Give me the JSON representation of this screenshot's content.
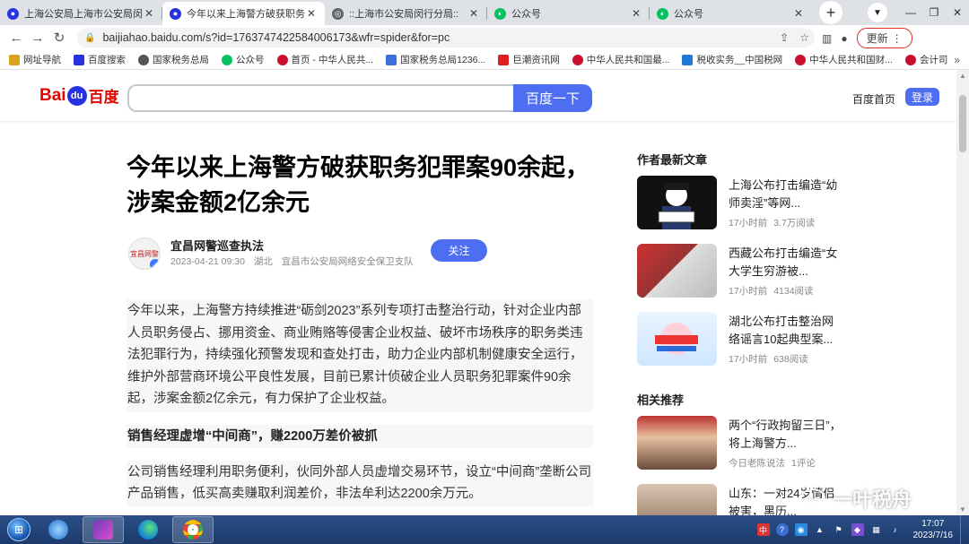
{
  "tabs": [
    {
      "label": "上海公安局上海市公安局闵行分局",
      "icon": "paw-icon",
      "color": "#2932e1",
      "active": false
    },
    {
      "label": "今年以来上海警方破获职务犯罪",
      "icon": "paw-icon",
      "color": "#2932e1",
      "active": true
    },
    {
      "label": "::上海市公安局闵行分局::",
      "icon": "globe-icon",
      "color": "#5f6368",
      "active": false
    },
    {
      "label": "公众号",
      "icon": "wechat-icon",
      "color": "#07c160",
      "active": false
    },
    {
      "label": "公众号",
      "icon": "wechat-icon",
      "color": "#07c160",
      "active": false
    }
  ],
  "address": {
    "url": "baijiahao.baidu.com/s?id=1763747422584006173&wfr=spider&for=pc",
    "update_label": "更新"
  },
  "bookmarks": [
    {
      "label": "网址导航",
      "color": "#d9a21b"
    },
    {
      "label": "百度搜索",
      "color": "#2932e1"
    },
    {
      "label": "国家税务总局",
      "color": "#555555"
    },
    {
      "label": "公众号",
      "color": "#07c160"
    },
    {
      "label": "首页 - 中华人民共...",
      "color": "#c8102e"
    },
    {
      "label": "国家税务总局1236...",
      "color": "#3b6fd9"
    },
    {
      "label": "巨潮资讯网",
      "color": "#e02020"
    },
    {
      "label": "中华人民共和国最...",
      "color": "#c8102e"
    },
    {
      "label": "税收实务__中国税网",
      "color": "#1b7bd6"
    },
    {
      "label": "中华人民共和国财...",
      "color": "#c8102e"
    },
    {
      "label": "会计司",
      "color": "#c8102e"
    }
  ],
  "header": {
    "logo_left": "Bai",
    "logo_du": "du",
    "logo_right": "百度",
    "search_button": "百度一下",
    "home_link": "百度首页",
    "login": "登录"
  },
  "article": {
    "title": "今年以来上海警方破获职务犯罪案90余起，涉案金额2亿余元",
    "author": "宜昌网警巡查执法",
    "avatar_text": "宜昌网警",
    "date": "2023-04-21 09:30",
    "location": "湖北",
    "org": "宜昌市公安局网络安全保卫支队",
    "follow": "关注",
    "p1": "今年以来，上海警方持续推进“砺剑2023”系列专项打击整治行动，针对企业内部人员职务侵占、挪用资金、商业贿赂等侵害企业权益、破坏市场秩序的职务类违法犯罪行为，持续强化预警发现和查处打击，助力企业内部机制健康安全运行，维护外部营商环境公平良性发展，目前已累计侦破企业人员职务犯罪案件90余起，涉案金额2亿余元，有力保护了企业权益。",
    "h1": "销售经理虚增“中间商”，赚2200万差价被抓",
    "p2": "公司销售经理利用职务便利，伙同外部人员虚增交易环节，设立“中间商”垄断公司产品销售，低买高卖赚取利润差价，非法牟利达2200余万元。"
  },
  "sidebar": {
    "latest_title": "作者最新文章",
    "latest": [
      {
        "title": "上海公布打击编造“幼师卖淫”等网...",
        "time": "17小时前",
        "reads": "3.7万阅读"
      },
      {
        "title": "西藏公布打击编造“女大学生穷游被...",
        "time": "17小时前",
        "reads": "4134阅读"
      },
      {
        "title": "湖北公布打击整治网络谣言10起典型案...",
        "time": "17小时前",
        "reads": "638阅读"
      }
    ],
    "related_title": "相关推荐",
    "related": [
      {
        "title": "两个“行政拘留三日”，将上海警方...",
        "time": "今日老陈说法",
        "reads": "1评论"
      },
      {
        "title": "山东：一对24岁情侣被害，黑历...",
        "time": "",
        "reads": ""
      }
    ]
  },
  "watermark": "一叶税舟",
  "taskbar": {
    "time": "17:07",
    "date": "2023/7/16"
  }
}
